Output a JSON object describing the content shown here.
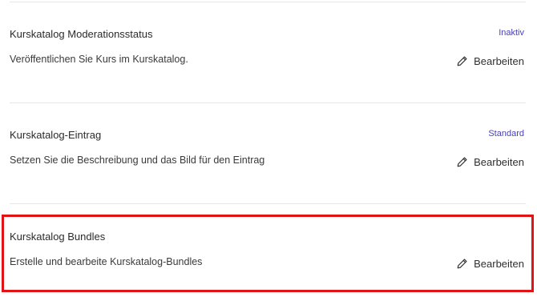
{
  "sections": [
    {
      "title": "Kurskatalog Moderationsstatus",
      "badge": "Inaktiv",
      "description": "Veröffentlichen Sie Kurs im Kurskatalog.",
      "edit_label": "Bearbeiten"
    },
    {
      "title": "Kurskatalog-Eintrag",
      "badge": "Standard",
      "description": "Setzen Sie die Beschreibung und das Bild für den Eintrag",
      "edit_label": "Bearbeiten"
    },
    {
      "title": "Kurskatalog Bundles",
      "badge": "",
      "description": "Erstelle und bearbeite Kurskatalog-Bundles",
      "edit_label": "Bearbeiten"
    }
  ],
  "colors": {
    "badge": "#4a3fb3",
    "highlight_border": "#e01414",
    "divider": "#e6e6e6"
  },
  "icons": {
    "edit": "pencil-icon"
  }
}
